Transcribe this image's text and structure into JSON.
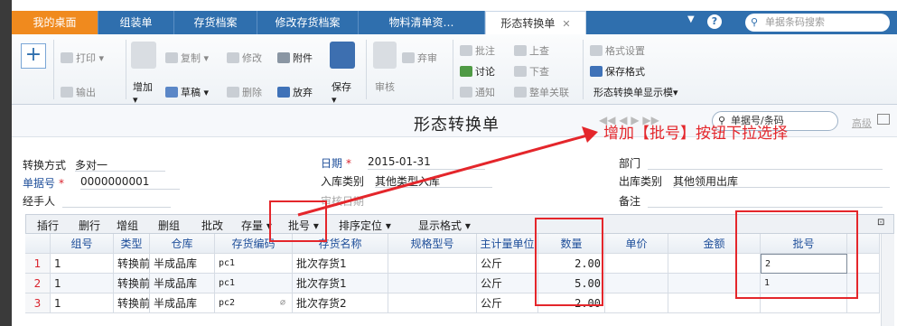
{
  "tabs": [
    {
      "label": "我的桌面",
      "name": "tab-desktop"
    },
    {
      "label": "组装单",
      "name": "tab-assembly"
    },
    {
      "label": "存货档案",
      "name": "tab-inventory-archive"
    },
    {
      "label": "修改存货档案",
      "name": "tab-edit-inventory-archive"
    },
    {
      "label": "物料清单资…",
      "name": "tab-bom"
    },
    {
      "label": "形态转换单",
      "name": "tab-form-conversion"
    }
  ],
  "header_right": {
    "help": "?",
    "search_placeholder": "单据条码搜索"
  },
  "toolbar": {
    "print": "打印",
    "export": "输出",
    "add": "增加",
    "copy": "复制",
    "draft": "草稿",
    "modify": "修改",
    "delete": "删除",
    "attach": "附件",
    "abandon": "放弃",
    "save": "保存",
    "audit": "审核",
    "discard": "弃审",
    "approve": "批注",
    "discuss": "讨论",
    "notify": "通知",
    "prev_page": "上查",
    "next_page": "下查",
    "whole_link": "整单关联",
    "format_settings": "格式设置",
    "save_format": "保存格式",
    "display_template": "形态转换单显示模▾"
  },
  "doc": {
    "title": "形态转换单",
    "bill_search": "单据号/条码",
    "advanced": "高级"
  },
  "form": {
    "conv_mode_label": "转换方式",
    "conv_mode": "多对一",
    "bill_no_label": "单据号",
    "bill_no": "0000000001",
    "handler_label": "经手人",
    "date_label": "日期",
    "date": "2015-01-31",
    "in_type_label": "入库类别",
    "in_type": "其他类型入库",
    "audit_date_label": "审核日期",
    "dept_label": "部门",
    "out_type_label": "出库类别",
    "out_type": "其他领用出库",
    "remark_label": "备注"
  },
  "grid_toolbar": [
    "插行",
    "删行",
    "增组",
    "删组",
    "批改",
    "存量 ▾",
    "批号 ▾",
    "排序定位 ▾",
    "显示格式 ▾"
  ],
  "columns": [
    "",
    "组号",
    "类型",
    "仓库",
    "存货编码",
    "存货名称",
    "规格型号",
    "主计量单位",
    "数量",
    "单价",
    "金额",
    "批号"
  ],
  "rows": [
    {
      "no": "1",
      "group": "1",
      "type": "转换前",
      "wh": "半成品库",
      "code": "pc1",
      "name": "批次存货1",
      "spec": "",
      "unit": "公斤",
      "qty": "2.00",
      "price": "",
      "amount": "",
      "batch": "2"
    },
    {
      "no": "2",
      "group": "1",
      "type": "转换前",
      "wh": "半成品库",
      "code": "pc1",
      "name": "批次存货1",
      "spec": "",
      "unit": "公斤",
      "qty": "5.00",
      "price": "",
      "amount": "",
      "batch": "1"
    },
    {
      "no": "3",
      "group": "1",
      "type": "转换前",
      "wh": "半成品库",
      "code": "pc2",
      "name": "批次存货2",
      "spec": "",
      "unit": "公斤",
      "qty": "2.00",
      "price": "",
      "amount": "",
      "batch": ""
    }
  ],
  "annotation": "增加【批号】按钮下拉选择",
  "colors": {
    "tab_bar": "#2f6fae",
    "home_tab": "#f08a1e",
    "annotation_red": "#e4262b"
  }
}
